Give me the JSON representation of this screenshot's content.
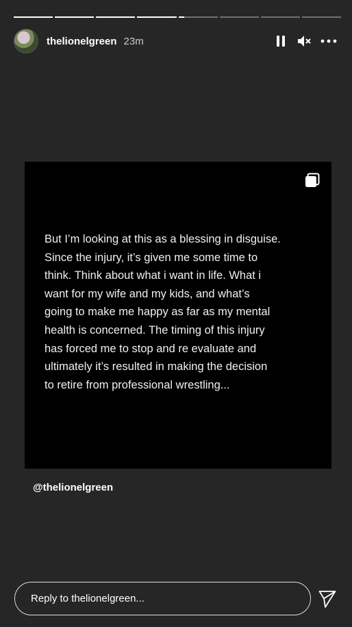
{
  "story": {
    "progress": [
      1,
      1,
      1,
      1,
      0.15,
      0,
      0,
      0
    ]
  },
  "header": {
    "username": "thelionelgreen",
    "time": "23m",
    "icons": {
      "avatar": "profile-avatar",
      "pause": "pause-icon",
      "mute": "muted-speaker-icon",
      "more": "more-options-icon"
    }
  },
  "post": {
    "text": "But I’m looking at this as a blessing in disguise.\nSince the injury, it’s given me some time to\nthink. Think about what i want in life. What i\nwant for my wife and my kids, and what’s\ngoing to make me happy as far as my mental\nhealth is concerned. The timing of this injury\nhas forced me to stop and re evaluate and\nultimately it’s resulted in making the decision\nto retire from professional wrestling...",
    "icon": "multiple-posts-icon"
  },
  "mention": "@thelionelgreen",
  "reply": {
    "placeholder": "Reply to thelionelgreen..."
  },
  "colors": {
    "background": "#262626",
    "post_background": "#000000",
    "text": "#ffffff"
  }
}
